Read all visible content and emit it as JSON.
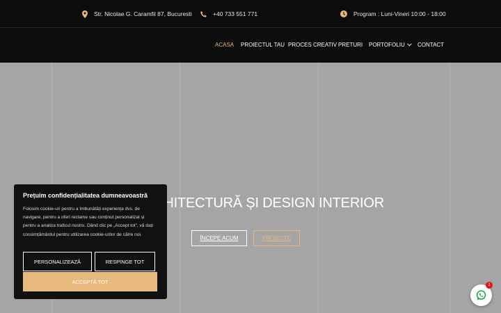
{
  "topbar": {
    "address": "Str. Nicolae G. Caramfil 87, Bucuresti",
    "phone": "+40 733 551 771",
    "schedule": "Program : Luni-Vineri 10:00 - 18:00",
    "icons": [
      "map-pin-icon",
      "phone-icon",
      "clock-icon"
    ]
  },
  "nav": {
    "items": [
      {
        "label": "ACASA",
        "active": true
      },
      {
        "label": "PROIECTUL TAU"
      },
      {
        "label": "PROCES CREATIV"
      },
      {
        "label": "PRETURI"
      },
      {
        "label": "PORTOFOLIU",
        "dropdown": true
      },
      {
        "label": "CONTACT"
      }
    ]
  },
  "hero": {
    "title": "ARHITECTURĂ ȘI DESIGN INTERIOR",
    "primary_button": "ÎNCEPE ACUM",
    "secondary_button": "PROIECTE"
  },
  "cookie": {
    "title": "Prețuim confidențialitatea dumneavoastră",
    "text": "Folosim cookie-uri pentru a îmbunătăți experiența dvs. de navigare, pentru a oferi reclame sau conținut personalizat și pentru a analiza traficul nostru. Dând clic pe „Accept tot”, vă dați consimțământul pentru utilizarea cookie-urilor de către noi.",
    "customize": "PERSONALIZEAZĂ",
    "reject": "RESPINGE TOT",
    "accept": "ACCEPTĂ TOT"
  },
  "whatsapp": {
    "badge": "1",
    "icon": "whatsapp-icon"
  },
  "colors": {
    "accent": "#e8b87d",
    "topbar_bg": "#0c0c0c",
    "hero_bg": "#a5a5a5",
    "badge": "#e0161b"
  }
}
